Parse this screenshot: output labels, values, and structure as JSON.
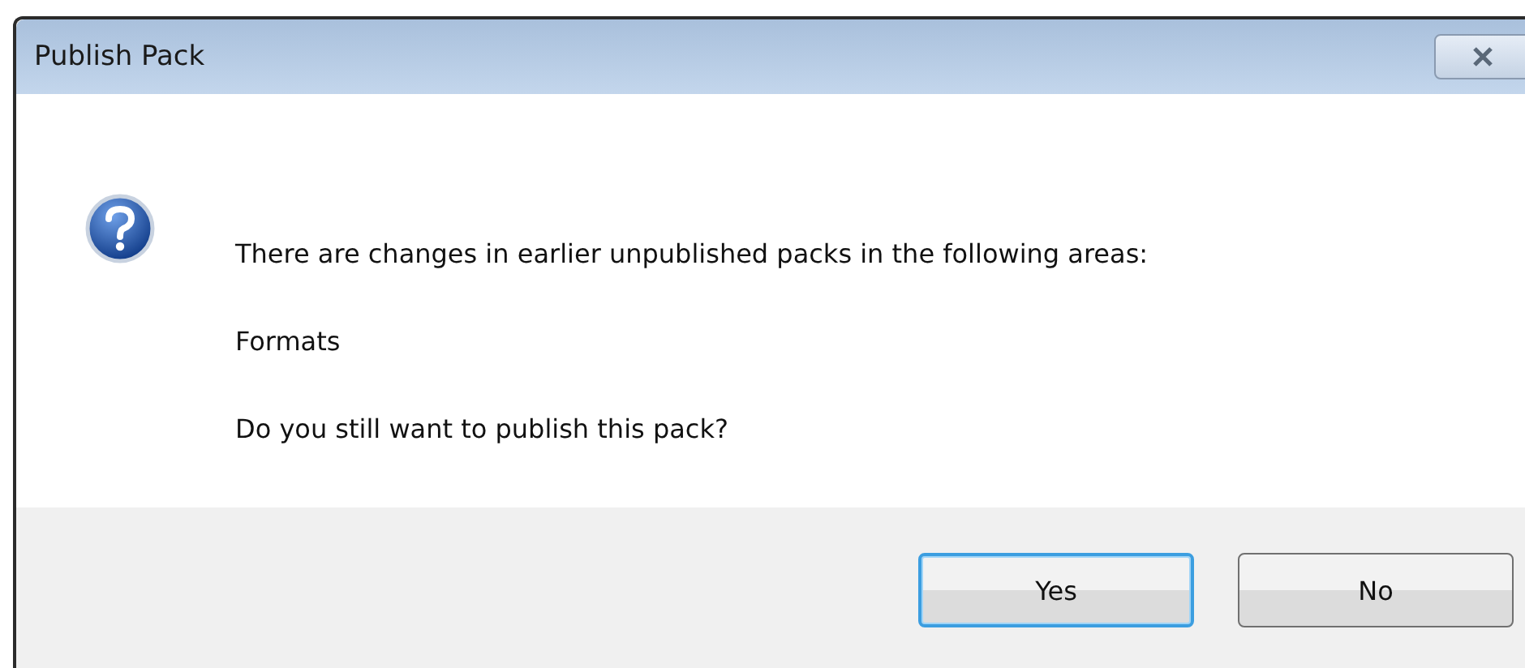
{
  "window": {
    "title": "Publish Pack"
  },
  "message": {
    "lines": [
      "There are changes in earlier unpublished packs in the following areas:",
      "Formats",
      "Do you still want to publish this pack?"
    ]
  },
  "buttons": [
    {
      "label": "Yes",
      "default": true
    },
    {
      "label": "No",
      "default": false
    }
  ]
}
